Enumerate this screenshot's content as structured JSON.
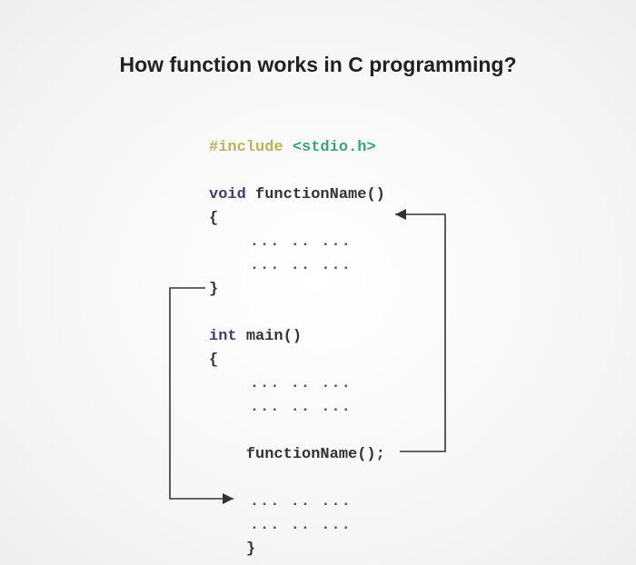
{
  "title": "How function works in C programming?",
  "code": {
    "include_directive": "#include",
    "include_header": "<stdio.h>",
    "fn_def_type": "void",
    "fn_def_name": "functionName",
    "fn_def_parens": "()",
    "open_brace": "{",
    "close_brace": "}",
    "body_dots": "... .. ...",
    "main_type": "int",
    "main_name": "main",
    "main_parens": "()",
    "fn_call": "functionName();"
  }
}
